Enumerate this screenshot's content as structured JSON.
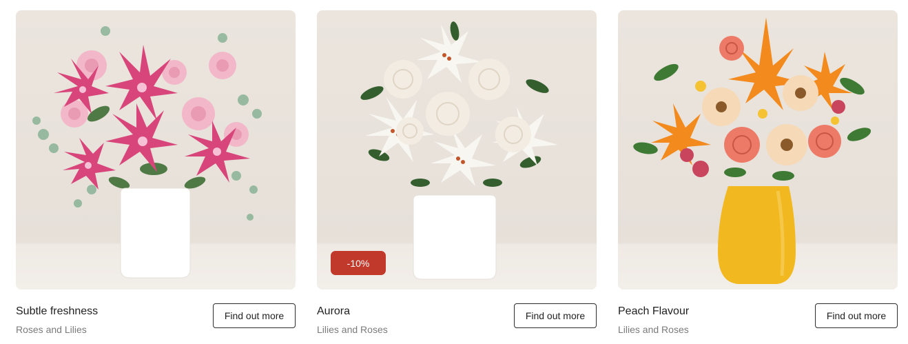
{
  "products": [
    {
      "title": "Subtle freshness",
      "subtitle": "Roses and Lilies",
      "cta": "Find out more",
      "image": "pink-lilies-and-roses-bouquet-white-vase",
      "vase_color": "#ffffff",
      "badge": ""
    },
    {
      "title": "Aurora",
      "subtitle": "Lilies and Roses",
      "cta": "Find out more",
      "image": "white-lilies-and-roses-bouquet-white-vase",
      "vase_color": "#ffffff",
      "badge": "-10%"
    },
    {
      "title": "Peach Flavour",
      "subtitle": "Lilies and Roses",
      "cta": "Find out more",
      "image": "orange-lilies-roses-gerberas-bouquet-yellow-vase",
      "vase_color": "#f2b81f",
      "badge": ""
    }
  ],
  "colors": {
    "badge_bg": "#c0392b",
    "button_border": "#2b2b2b"
  }
}
